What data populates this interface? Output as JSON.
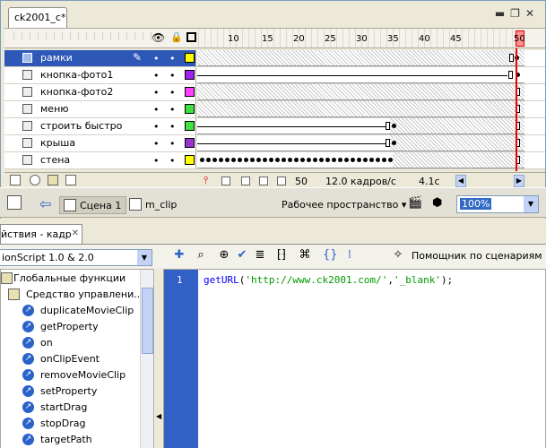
{
  "timeline": {
    "doc_tab": "ck2001_c*",
    "ruler_numbers": [
      "10",
      "15",
      "20",
      "25",
      "30",
      "35",
      "40",
      "45",
      "50"
    ],
    "layers": [
      {
        "name": "рамки",
        "selected": true,
        "color": "#ffff00"
      },
      {
        "name": "кнопка-фото1",
        "selected": false,
        "color": "#a020f0"
      },
      {
        "name": "кнопка-фото2",
        "selected": false,
        "color": "#ff40ff"
      },
      {
        "name": "меню",
        "selected": false,
        "color": "#40e040"
      },
      {
        "name": "строить быстро",
        "selected": false,
        "color": "#40e040"
      },
      {
        "name": "крыша",
        "selected": false,
        "color": "#9933cc"
      },
      {
        "name": "стена",
        "selected": false,
        "color": "#ffff00"
      }
    ],
    "current_frame": "50",
    "frame_rate": "12.0 кадров/с",
    "elapsed": "4.1с"
  },
  "edit_bar": {
    "scene": "Сцена 1",
    "clip": "m_clip",
    "workspace": "Рабочее пространство",
    "zoom": "100%"
  },
  "actions": {
    "tab_label": "йствия - кадр",
    "version_select": "ionScript 1.0 & 2.0",
    "helper_label": "Помощник по сценариям",
    "toolbox": {
      "categories": [
        "Глобальные функции",
        "Средство управлени..."
      ],
      "items": [
        "duplicateMovieClip",
        "getProperty",
        "on",
        "onClipEvent",
        "removeMovieClip",
        "setProperty",
        "startDrag",
        "stopDrag",
        "targetPath"
      ]
    },
    "code": {
      "line_number": "1",
      "func": "getURL",
      "open": "(",
      "arg1": "'http://www.ck2001.com/'",
      "comma": ",",
      "arg2": "'_blank'",
      "close": ");"
    }
  }
}
